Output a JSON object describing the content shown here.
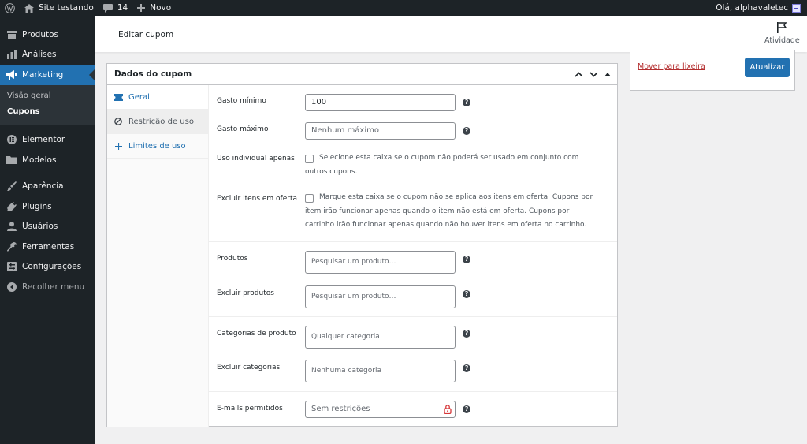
{
  "admin_bar": {
    "site_name": "Site testando",
    "comments_count": "14",
    "new_label": "Novo",
    "greeting": "Olá, alphavaletec"
  },
  "sidebar": {
    "items": [
      {
        "label": "Produtos",
        "icon": "box-icon"
      },
      {
        "label": "Análises",
        "icon": "bar-chart-icon"
      },
      {
        "label": "Marketing",
        "icon": "megaphone-icon",
        "current": true
      },
      {
        "label": "Elementor",
        "icon": "elementor-icon"
      },
      {
        "label": "Modelos",
        "icon": "folder-icon"
      },
      {
        "label": "Aparência",
        "icon": "paintbrush-icon"
      },
      {
        "label": "Plugins",
        "icon": "plug-icon"
      },
      {
        "label": "Usuários",
        "icon": "user-icon"
      },
      {
        "label": "Ferramentas",
        "icon": "wrench-icon"
      },
      {
        "label": "Configurações",
        "icon": "settings-icon"
      }
    ],
    "submenu": [
      {
        "label": "Visão geral"
      },
      {
        "label": "Cupons",
        "current": true
      }
    ],
    "collapse_label": "Recolher menu"
  },
  "header": {
    "title": "Editar cupom",
    "activity_label": "Atividade"
  },
  "publish": {
    "trash_label": "Mover para lixeira",
    "update_label": "Atualizar"
  },
  "coupon_data": {
    "title": "Dados do cupom",
    "tabs": [
      {
        "label": "Geral",
        "icon": "ticket-icon"
      },
      {
        "label": "Restrição de uso",
        "icon": "block-icon",
        "active": true
      },
      {
        "label": "Limites de uso",
        "icon": "plus-icon"
      }
    ],
    "fields": {
      "min_spend": {
        "label": "Gasto mínimo",
        "value": "100"
      },
      "max_spend": {
        "label": "Gasto máximo",
        "placeholder": "Nenhum máximo"
      },
      "individual_use": {
        "label": "Uso individual apenas",
        "description": "Selecione esta caixa se o cupom não poderá ser usado em conjunto com outros cupons."
      },
      "exclude_sale": {
        "label": "Excluir itens em oferta",
        "description": "Marque esta caixa se o cupom não se aplica aos itens em oferta. Cupons por item irão funcionar apenas quando o item não está em oferta. Cupons por carrinho irão funcionar apenas quando não houver itens em oferta no carrinho."
      },
      "products": {
        "label": "Produtos",
        "placeholder": "Pesquisar um produto…"
      },
      "exclude_products": {
        "label": "Excluir produtos",
        "placeholder": "Pesquisar um produto…"
      },
      "categories": {
        "label": "Categorias de produto",
        "placeholder": "Qualquer categoria"
      },
      "exclude_categories": {
        "label": "Excluir categorias",
        "placeholder": "Nenhuma categoria"
      },
      "emails": {
        "label": "E-mails permitidos",
        "placeholder": "Sem restrições"
      }
    },
    "help_glyph": "?"
  },
  "colors": {
    "admin_dark": "#1d2327",
    "accent_blue": "#2271b1",
    "trash_red": "#b32d2e"
  }
}
